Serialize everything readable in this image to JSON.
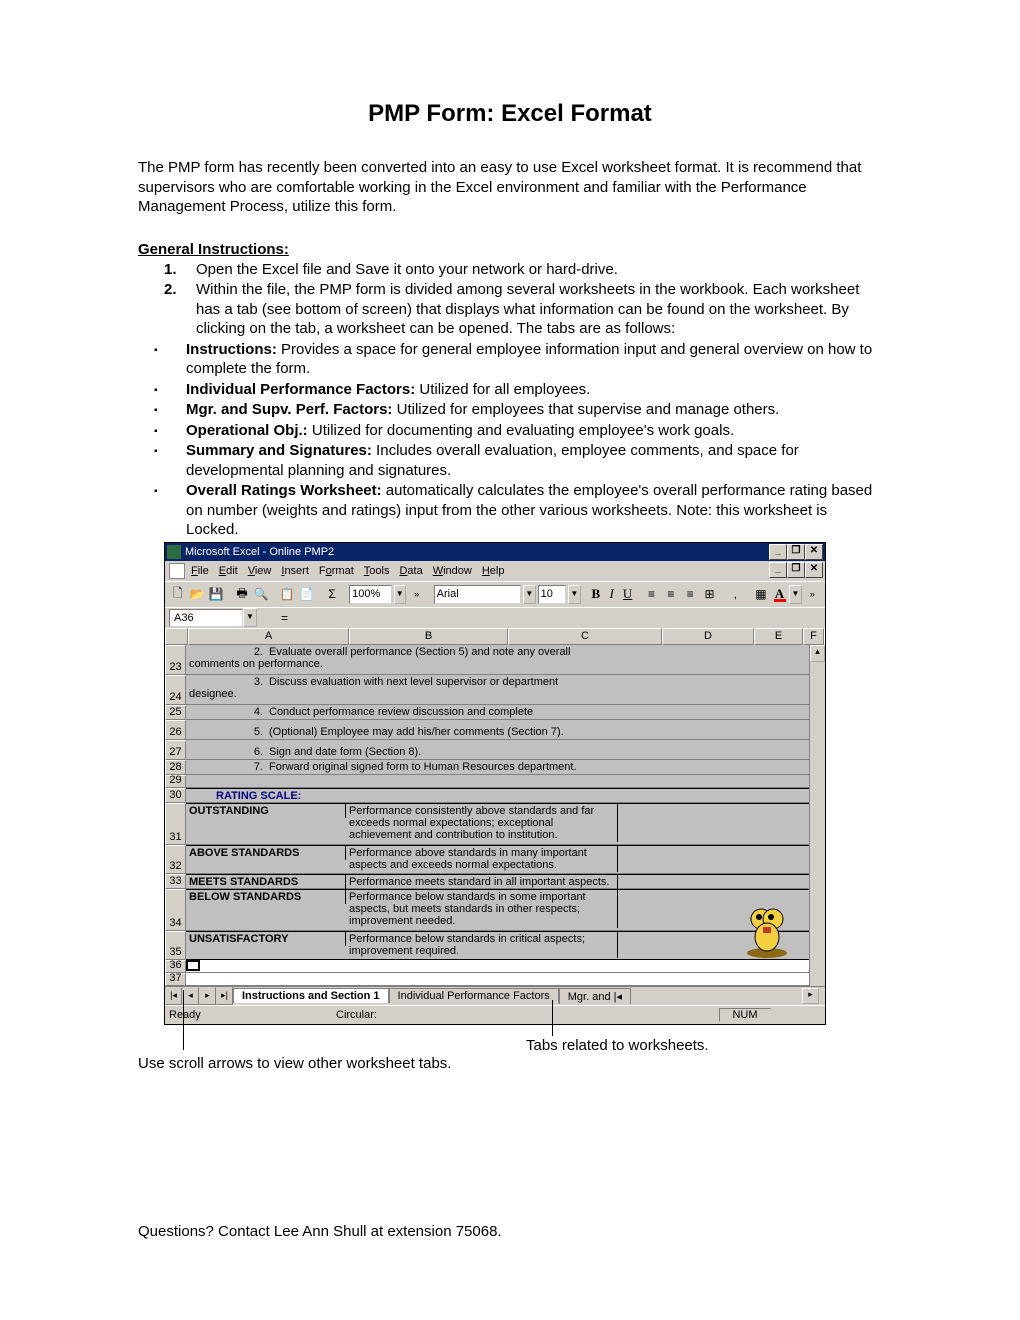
{
  "title": "PMP Form:  Excel Format",
  "intro": "The PMP form has recently been converted into an easy to use Excel worksheet format.  It is recommend that supervisors who are comfortable working in the Excel environment and familiar with the Performance Management Process, utilize this form.",
  "gi_heading": "General Instructions:",
  "num1": "1.",
  "num1_text": "Open the Excel file and Save it onto your network or hard-drive.",
  "num2": "2.",
  "num2_text": "Within the file, the PMP form is divided among several worksheets in the workbook.  Each worksheet has a tab (see bottom of screen) that displays what information can be found on the worksheet. By clicking on the tab, a worksheet can be opened. The tabs are as follows:",
  "b1_label": "Instructions:",
  "b1_text": "  Provides a space for general employee information input and general overview on how to complete the form.",
  "b2_label": "Individual Performance Factors:",
  "b2_text": "  Utilized for all employees.",
  "b3_label": "Mgr. and Supv. Perf. Factors:",
  "b3_text": "  Utilized for employees that supervise and manage others.",
  "b4_label": "Operational Obj.:",
  "b4_text": "  Utilized for documenting and evaluating employee's work goals.",
  "b5_label": "Summary and Signatures:",
  "b5_text": "  Includes overall evaluation, employee comments, and space for developmental planning and signatures.",
  "b6_label": "Overall Ratings Worksheet:",
  "b6_text": "  automatically calculates the employee's overall performance rating based on number (weights and ratings) input from the other various worksheets.  Note:  this worksheet is Locked.",
  "excel": {
    "titlebar": "Microsoft Excel - Online PMP2",
    "menus": {
      "file": "File",
      "edit": "Edit",
      "view": "View",
      "insert": "Insert",
      "format": "Format",
      "tools": "Tools",
      "data": "Data",
      "window": "Window",
      "help": "Help"
    },
    "zoom": "100%",
    "font": "Arial",
    "fontsize": "10",
    "namebox": "A36",
    "cols": {
      "a": "A",
      "b": "B",
      "c": "C",
      "d": "D",
      "e": "E",
      "f": "F"
    },
    "rows": {
      "r23": {
        "num": "23",
        "n": "2.",
        "t": "Evaluate overall performance (Section 5) and note any overall",
        "t2": "comments on performance."
      },
      "r24": {
        "num": "24",
        "n": "3.",
        "t": "Discuss evaluation with next level supervisor or department",
        "t2": "designee."
      },
      "r25": {
        "num": "25",
        "n": "4.",
        "t": "Conduct performance review discussion and complete"
      },
      "r26": {
        "num": "26",
        "n": "5.",
        "t": "(Optional) Employee may add his/her comments (Section 7)."
      },
      "r27": {
        "num": "27",
        "n": "6.",
        "t": "Sign and date form (Section 8)."
      },
      "r28": {
        "num": "28",
        "n": "7.",
        "t": "Forward original signed form to Human Resources department."
      },
      "r29": {
        "num": "29"
      },
      "r30": {
        "num": "30",
        "h": "RATING SCALE:"
      },
      "r31": {
        "num": "31",
        "lbl": "OUTSTANDING",
        "desc": "Performance consistently above standards and far exceeds normal expectations; exceptional achievement and contribution to institution."
      },
      "r32": {
        "num": "32",
        "lbl": "ABOVE STANDARDS",
        "desc": "Performance above standards in many important aspects and exceeds normal expectations."
      },
      "r33": {
        "num": "33",
        "lbl": "MEETS STANDARDS",
        "desc": "Performance meets standard in all important aspects."
      },
      "r34": {
        "num": "34",
        "lbl": "BELOW STANDARDS",
        "desc": "Performance below standards in some important aspects, but meets standards in other respects; improvement needed."
      },
      "r35": {
        "num": "35",
        "lbl": "UNSATISFACTORY",
        "desc": "Performance below standards in critical aspects; improvement required."
      },
      "r36": {
        "num": "36"
      },
      "r37": {
        "num": "37"
      }
    },
    "tabs": {
      "t1": "Instructions and Section 1",
      "t2": "Individual Performance Factors",
      "t3": "Mgr. and"
    },
    "status": {
      "ready": "Ready",
      "circular": "Circular:",
      "num": "NUM"
    }
  },
  "callout_left": "Use scroll arrows to view other worksheet tabs.",
  "callout_right": "Tabs related to worksheets.",
  "footer": "Questions?  Contact Lee Ann Shull at extension 75068."
}
